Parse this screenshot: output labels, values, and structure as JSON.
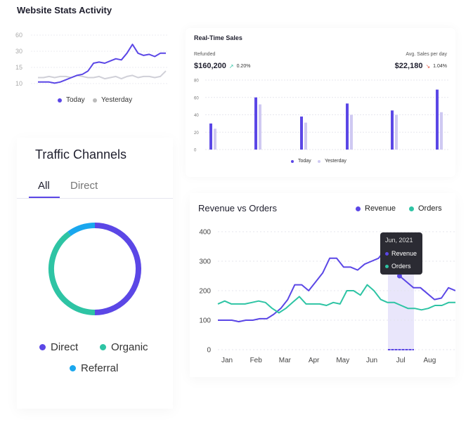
{
  "page_title": "Website Stats Activity",
  "colors": {
    "today": "#5b47e6",
    "yesterday": "#d0d0d8",
    "revenue": "#5b47e6",
    "orders": "#2ec4a4",
    "referral": "#1aa7ee",
    "bar_yesterday": "#cfc9f2"
  },
  "stats": {
    "legend": {
      "today": "Today",
      "yesterday": "Yesterday"
    },
    "chart_data": {
      "type": "line",
      "yticks": [
        "60",
        "30",
        "15",
        "10"
      ],
      "series": [
        {
          "name": "Today",
          "values": [
            10,
            10,
            10,
            9,
            10,
            12,
            14,
            16,
            17,
            20,
            27,
            28,
            27,
            29,
            31,
            30,
            36,
            44,
            36,
            34,
            35,
            33,
            36,
            36
          ]
        },
        {
          "name": "Yesterday",
          "values": [
            14,
            14,
            15,
            14,
            15,
            15,
            14,
            16,
            15,
            14,
            14,
            15,
            13,
            14,
            15,
            13,
            15,
            16,
            14,
            15,
            15,
            14,
            15,
            20
          ]
        }
      ]
    }
  },
  "sales": {
    "title": "Real-Time Sales",
    "refunded_label": "Refunded",
    "refunded_value": "$160,200",
    "refunded_change": "0.20%",
    "avg_label": "Avg. Sales per day",
    "avg_value": "$22,180",
    "avg_change": "1.04%",
    "legend": {
      "today": "Today",
      "yesterday": "Yesterday"
    },
    "chart_data": {
      "type": "bar",
      "ylim": [
        0,
        80
      ],
      "yticks": [
        "80",
        "60",
        "40",
        "20",
        "0"
      ],
      "series": [
        {
          "name": "Today",
          "values": [
            30,
            60,
            38,
            53,
            45,
            69
          ]
        },
        {
          "name": "Yesterday",
          "values": [
            24,
            52,
            31,
            40,
            40,
            43
          ]
        }
      ]
    }
  },
  "traffic": {
    "title": "Traffic Channels",
    "tabs": [
      "All",
      "Direct"
    ],
    "legend": {
      "direct": "Direct",
      "organic": "Organic",
      "referral": "Referral"
    },
    "chart_data": {
      "type": "pie",
      "slices": [
        {
          "name": "Direct",
          "value": 50
        },
        {
          "name": "Organic",
          "value": 40
        },
        {
          "name": "Referral",
          "value": 10
        }
      ]
    }
  },
  "revenue": {
    "title": "Revenue vs Orders",
    "legend": {
      "revenue": "Revenue",
      "orders": "Orders"
    },
    "tooltip": {
      "date": "Jun, 2021",
      "revenue": "Revenue",
      "orders": "Orders"
    },
    "chart_data": {
      "type": "line",
      "ylim": [
        0,
        400
      ],
      "yticks": [
        "400",
        "300",
        "200",
        "100",
        "0"
      ],
      "categories": [
        "Jan",
        "Feb",
        "Mar",
        "Apr",
        "May",
        "Jun",
        "Jul",
        "Aug"
      ],
      "series": [
        {
          "name": "Revenue",
          "values": [
            100,
            100,
            100,
            95,
            100,
            100,
            105,
            105,
            120,
            140,
            170,
            220,
            220,
            200,
            230,
            260,
            310,
            310,
            280,
            280,
            270,
            290,
            300,
            310,
            340,
            310,
            250,
            230,
            210,
            210,
            190,
            170,
            175,
            210,
            200
          ]
        },
        {
          "name": "Orders",
          "values": [
            155,
            165,
            155,
            155,
            155,
            160,
            165,
            160,
            140,
            125,
            140,
            160,
            180,
            155,
            155,
            155,
            150,
            160,
            155,
            200,
            200,
            185,
            220,
            200,
            170,
            160,
            160,
            150,
            140,
            140,
            135,
            140,
            150,
            150,
            160,
            160
          ]
        }
      ]
    }
  }
}
